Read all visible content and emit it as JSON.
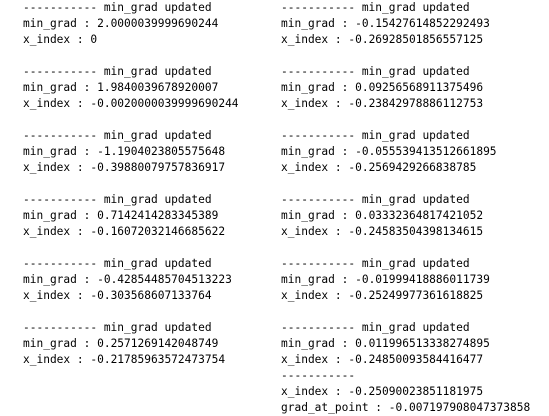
{
  "header_text": "----------- min_grad updated",
  "min_grad_label": "min_grad : ",
  "x_index_label": "x_index : ",
  "left_blocks": [
    {
      "min_grad": "2.0000039999690244",
      "x_index": "0"
    },
    {
      "min_grad": "1.9840039678920007",
      "x_index": "-0.0020000039999690244"
    },
    {
      "min_grad": "-1.1904023805575648",
      "x_index": "-0.39880079757836917"
    },
    {
      "min_grad": "0.7142414283345389",
      "x_index": "-0.16072032146685622"
    },
    {
      "min_grad": "-0.42854485704513223",
      "x_index": "-0.303568607133764"
    },
    {
      "min_grad": "0.2571269142048749",
      "x_index": "-0.21785963572473754"
    }
  ],
  "right_blocks": [
    {
      "min_grad": "-0.15427614852292493",
      "x_index": "-0.26928501856557125"
    },
    {
      "min_grad": "0.09256568911375496",
      "x_index": "-0.23842978886112753"
    },
    {
      "min_grad": "-0.055539413512661895",
      "x_index": "-0.2569429266838785"
    },
    {
      "min_grad": "0.03332364817421052",
      "x_index": "-0.24583504398134615"
    },
    {
      "min_grad": "-0.01999418886011739",
      "x_index": "-0.25249977361618825"
    },
    {
      "min_grad": "0.011996513338274895",
      "x_index": "-0.24850093584416477"
    }
  ],
  "final": {
    "separator": "-----------",
    "x_index_line": "x_index : -0.25090023851181975",
    "grad_line": "grad_at_point : -0.007197908047373858"
  }
}
